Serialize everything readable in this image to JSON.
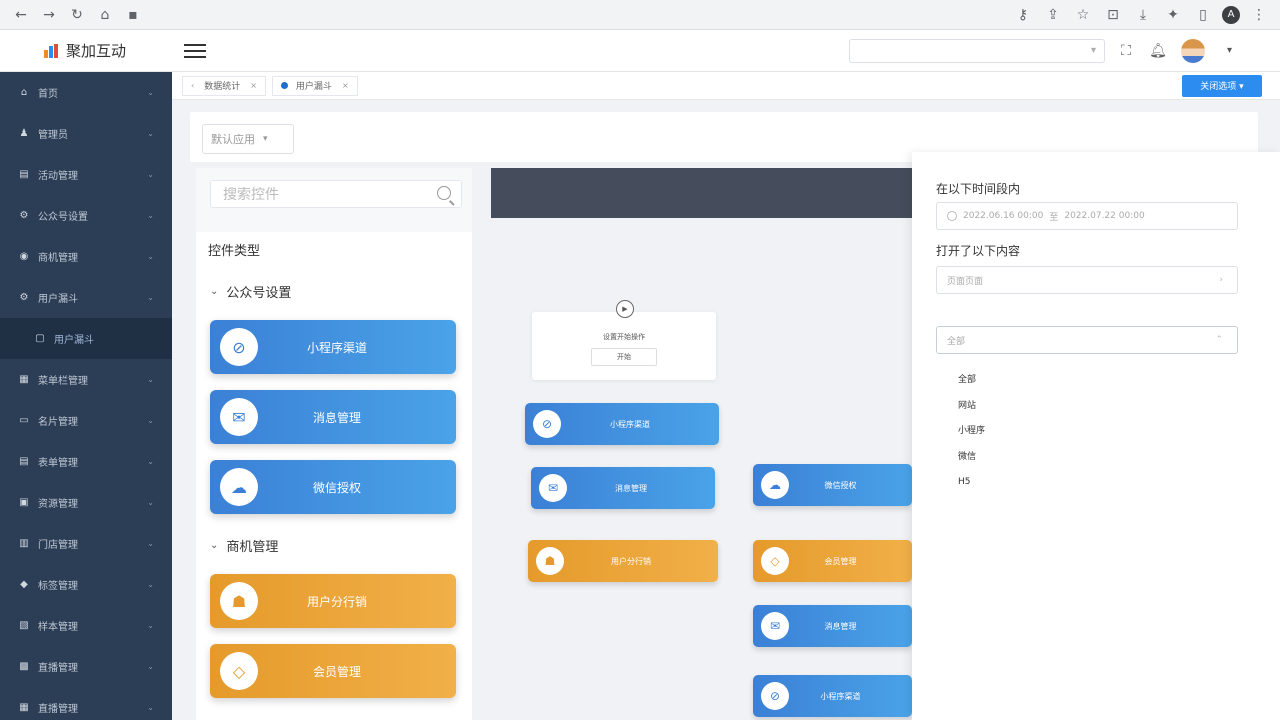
{
  "browser": {
    "nav_icons": [
      "back-icon",
      "forward-icon",
      "reload-icon",
      "home-icon",
      "lock-icon"
    ],
    "right_icons": [
      "key-icon",
      "share-icon",
      "star-icon",
      "screenshot-icon",
      "download-icon",
      "extensions-icon",
      "sidepanel-icon"
    ],
    "profile_initial": "A",
    "menu_glyph": "⋮"
  },
  "header": {
    "logo_text": "聚加互动",
    "search_caret": "▾",
    "caret": "▾"
  },
  "sidebar": {
    "items": [
      {
        "label": "首页",
        "icon": "home-icon",
        "glyph": "⌂"
      },
      {
        "label": "管理员",
        "icon": "user-icon",
        "glyph": "♟"
      },
      {
        "label": "活动管理",
        "icon": "activity-icon",
        "glyph": "▤"
      },
      {
        "label": "公众号设置",
        "icon": "settings-icon",
        "glyph": "⚙"
      },
      {
        "label": "商机管理",
        "icon": "opportunity-icon",
        "glyph": "◉"
      },
      {
        "label": "用户漏斗",
        "icon": "funnel-icon",
        "glyph": "⚙"
      },
      {
        "label": "用户漏斗",
        "icon": "funnel-sub-icon",
        "glyph": "▢",
        "sub": true
      },
      {
        "label": "菜单栏管理",
        "icon": "menu-grid-icon",
        "glyph": "▦"
      },
      {
        "label": "名片管理",
        "icon": "card-icon",
        "glyph": "▭"
      },
      {
        "label": "表单管理",
        "icon": "form-icon",
        "glyph": "▤"
      },
      {
        "label": "资源管理",
        "icon": "resource-icon",
        "glyph": "▣"
      },
      {
        "label": "门店管理",
        "icon": "store-icon",
        "glyph": "▥"
      },
      {
        "label": "标签管理",
        "icon": "tag-icon",
        "glyph": "◆"
      },
      {
        "label": "样本管理",
        "icon": "sample-icon",
        "glyph": "▧"
      },
      {
        "label": "直播管理",
        "icon": "live-icon",
        "glyph": "▩"
      },
      {
        "label": "直播管理",
        "icon": "live2-icon",
        "glyph": "▦"
      }
    ]
  },
  "tabs": {
    "items": [
      {
        "label": "数据统计",
        "active": false
      },
      {
        "label": "用户漏斗",
        "active": true
      }
    ],
    "close_glyph": "×",
    "close_button_label": "关闭选项 ▾"
  },
  "filter": {
    "app_select_value": "默认应用",
    "caret": "▾"
  },
  "palette": {
    "search_placeholder": "搜索控件",
    "title": "控件类型",
    "groups": [
      {
        "title": "公众号设置",
        "widgets": [
          {
            "label": "小程序渠道",
            "color": "blue",
            "icon": "link-icon",
            "glyph": "⊘"
          },
          {
            "label": "消息管理",
            "color": "blue",
            "icon": "mail-icon",
            "glyph": "✉"
          },
          {
            "label": "微信授权",
            "color": "blue",
            "icon": "wechat-icon",
            "glyph": "☁"
          }
        ]
      },
      {
        "title": "商机管理",
        "widgets": [
          {
            "label": "用户分行销",
            "color": "orange",
            "icon": "org-chart-icon",
            "glyph": "☗"
          },
          {
            "label": "会员管理",
            "color": "orange",
            "icon": "diamond-icon",
            "glyph": "◇"
          }
        ]
      }
    ]
  },
  "canvas": {
    "start_node": {
      "play_glyph": "▶",
      "text": "设置开始操作",
      "button": "开始"
    },
    "nodes": [
      {
        "label": "小程序渠道",
        "color": "blue",
        "icon": "link-icon",
        "glyph": "⊘"
      },
      {
        "label": "消息管理",
        "color": "blue",
        "icon": "mail-icon",
        "glyph": "✉"
      },
      {
        "label": "用户分行销",
        "color": "orange",
        "icon": "org-chart-icon",
        "glyph": "☗"
      },
      {
        "label": "微信授权",
        "color": "blue",
        "icon": "wechat-icon",
        "glyph": "☁"
      },
      {
        "label": "会员管理",
        "color": "orange",
        "icon": "diamond-icon",
        "glyph": "◇"
      },
      {
        "label": "消息管理",
        "color": "blue",
        "icon": "mail-icon",
        "glyph": "✉"
      },
      {
        "label": "小程序渠道",
        "color": "blue",
        "icon": "link-icon",
        "glyph": "⊘"
      }
    ]
  },
  "drawer": {
    "time_label": "在以下时间段内",
    "date_start": "2022.06.16 00:00",
    "date_sep": "至",
    "date_end": "2022.07.22 00:00",
    "content_label": "打开了以下内容",
    "content_placeholder": "页面页面",
    "content_arrow": "›",
    "channel_value": "全部",
    "channel_arrow": "⌃",
    "channel_options": [
      "全部",
      "网站",
      "小程序",
      "微信",
      "H5"
    ]
  },
  "colors": {
    "sidebar_bg": "#2c3e56",
    "primary_blue": "#3b80d6",
    "accent_orange": "#e59a2b",
    "button_blue": "#2d8cf0"
  }
}
